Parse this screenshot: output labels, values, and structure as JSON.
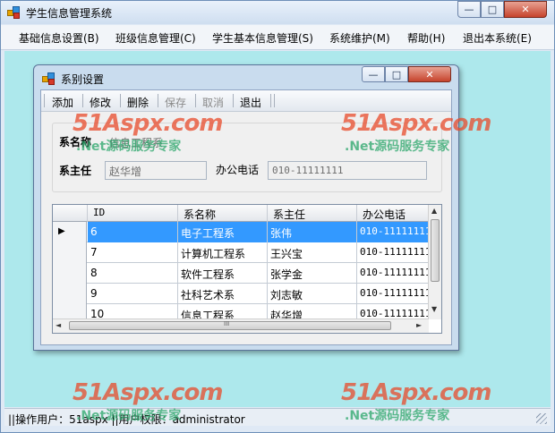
{
  "app": {
    "title": "学生信息管理系统",
    "controls": {
      "minimize": "—",
      "maximize": "□",
      "close": "✕"
    }
  },
  "menu": [
    "基础信息设置(B)",
    "班级信息管理(C)",
    "学生基本信息管理(S)",
    "系统维护(M)",
    "帮助(H)",
    "退出本系统(E)"
  ],
  "dialog": {
    "title": "系别设置",
    "controls": {
      "minimize": "—",
      "maximize": "□",
      "close": "✕"
    },
    "toolbar": {
      "add": "添加",
      "edit": "修改",
      "delete": "删除",
      "save": "保存",
      "cancel": "取消",
      "exit": "退出"
    },
    "form": {
      "dept_name_label": "系名称",
      "dept_name_value": "信息工程系",
      "head_label": "系主任",
      "head_value": "赵华增",
      "phone_label": "办公电话",
      "phone_value": "010-11111111"
    },
    "grid": {
      "columns": [
        "ID",
        "系名称",
        "系主任",
        "办公电话"
      ],
      "rows": [
        {
          "id": "6",
          "name": "电子工程系",
          "head": "张伟",
          "phone": "010-11111111"
        },
        {
          "id": "7",
          "name": "计算机工程系",
          "head": "王兴宝",
          "phone": "010-11111111"
        },
        {
          "id": "8",
          "name": "软件工程系",
          "head": "张学金",
          "phone": "010-11111111"
        },
        {
          "id": "9",
          "name": "社科艺术系",
          "head": "刘志敏",
          "phone": "010-11111111"
        },
        {
          "id": "10",
          "name": "信息工程系",
          "head": "赵华增",
          "phone": "010-11111111"
        }
      ],
      "selected_row": 0,
      "row_pointer": "▶",
      "scroll": {
        "up": "▲",
        "down": "▼",
        "left": "◄",
        "right": "►",
        "grip": "III"
      }
    }
  },
  "status": {
    "text": "||操作用户：51aspx  ||用户权限：administrator"
  },
  "watermark": {
    "logo": "51Aspx",
    "domain": ".com",
    "tagline": ".Net源码服务专家"
  }
}
